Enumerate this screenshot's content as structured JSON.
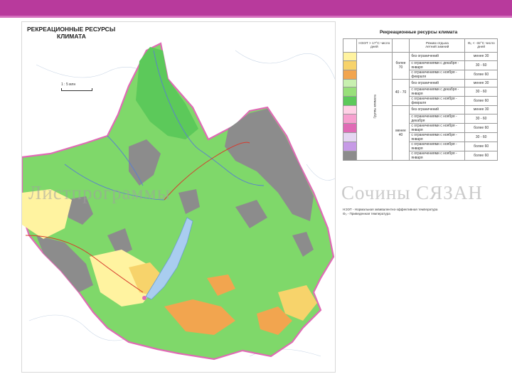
{
  "slide": {
    "accent_color": "#b83a9c"
  },
  "map": {
    "title_line1": "РЕКРЕАЦИОННЫЕ РЕСУРСЫ",
    "title_line2": "КЛИМАТА",
    "scale_label": "1 : 5 млн"
  },
  "legend": {
    "title": "Рекреационные ресурсы климата",
    "col_header_1": "НЭЭТ > 17°C число дней",
    "col_header_2": "Режим отдыха",
    "col_header_2a": "летний",
    "col_header_2b": "зимний",
    "col_header_3": "Θ₀ < -32°C число дней",
    "group_label": "Группы климата",
    "regime_label": "без ограничений",
    "day_groups": [
      "более 70",
      "40 - 70",
      "менее 40"
    ],
    "rows": [
      {
        "color": "#fff3a0",
        "regime": "без ограничений",
        "days": "менее 30"
      },
      {
        "color": "#f7d36b",
        "regime": "с ограничениями с декабря - января",
        "days": "30 - 60"
      },
      {
        "color": "#f2a54f",
        "regime": "с ограничениями с ноября - февраля",
        "days": "более 60"
      },
      {
        "color": "#c8f0b0",
        "regime": "без ограничений",
        "days": "менее 30"
      },
      {
        "color": "#98e07a",
        "regime": "с ограничениями с декабря - января",
        "days": "30 - 60"
      },
      {
        "color": "#5cc95a",
        "regime": "с ограничениями с ноября - февраля",
        "days": "более 60"
      },
      {
        "color": "#ffd1e6",
        "regime": "без ограничений",
        "days": "менее 30"
      },
      {
        "color": "#f7a0cf",
        "regime": "с ограничениями с ноября - декабря",
        "days": "30 - 60"
      },
      {
        "color": "#e06ab5",
        "regime": "с ограничениями с ноября - января",
        "days": "более 60"
      },
      {
        "color": "#e5d6f2",
        "regime": "с ограничениями с ноября - января",
        "days": "30 - 60"
      },
      {
        "color": "#c69ae6",
        "regime": "с ограничениями с ноября - января",
        "days": "более 60"
      },
      {
        "color": "#8c8c8c",
        "regime": "с ограничениями с ноября - января",
        "days": "более 60"
      }
    ],
    "note_line1": "НЭЭТ - Нормальная эквивалентно-эффективная температура",
    "note_line2": "Θ₀ - Приведенная температура"
  },
  "watermark": {
    "left": "Листпрограммы",
    "right": "Сочины СЯЗАН"
  }
}
